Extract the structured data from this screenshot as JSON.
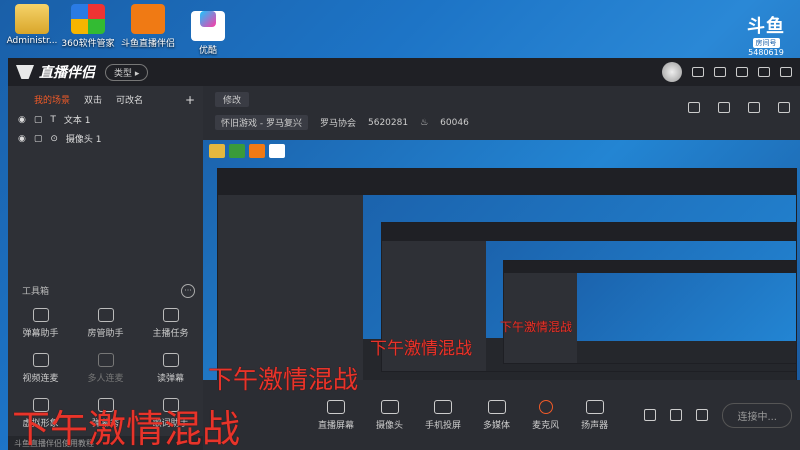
{
  "desktop": {
    "icons": [
      {
        "label": "Administr...",
        "icon": "folder-icon"
      },
      {
        "label": "360软件管家",
        "icon": "360-icon"
      },
      {
        "label": "斗鱼直播伴侣",
        "icon": "douyu-icon"
      },
      {
        "label": "优酷",
        "icon": "youku-icon"
      }
    ],
    "room_badge": {
      "logo": "斗鱼",
      "tag": "房间号",
      "room_id": "5480619"
    }
  },
  "app": {
    "title": "直播伴侣",
    "type_button": "类型 ▸",
    "sidebar": {
      "tabs": [
        "我的场景",
        "双击",
        "可改名"
      ],
      "add_label": "+",
      "sources": [
        {
          "label": "文本 1",
          "icon": "text-icon"
        },
        {
          "label": "摄像头 1",
          "icon": "camera-icon"
        }
      ],
      "toolbox_label": "工具箱",
      "more_label": "···",
      "tools": [
        {
          "label": "弹幕助手",
          "icon": "danmu-icon",
          "enabled": true
        },
        {
          "label": "房管助手",
          "icon": "admin-icon",
          "enabled": true
        },
        {
          "label": "主播任务",
          "icon": "task-icon",
          "enabled": true
        },
        {
          "label": "视频连麦",
          "icon": "video-link-icon",
          "enabled": true
        },
        {
          "label": "多人连麦",
          "icon": "multi-link-icon",
          "enabled": false
        },
        {
          "label": "读弹幕",
          "icon": "read-danmu-icon",
          "enabled": true
        },
        {
          "label": "虚拟形象",
          "icon": "avatar-icon",
          "enabled": true
        },
        {
          "label": "弹幕秀",
          "icon": "danmu-show-icon",
          "enabled": true
        },
        {
          "label": "歌词助手",
          "icon": "lyrics-icon",
          "enabled": true
        }
      ],
      "status_text": "斗鱼直播伴侣使用教程"
    },
    "main": {
      "edit_button": "修改",
      "category": "怀旧游戏 - 罗马复兴",
      "room_name": "罗马协会",
      "room_id": "5620281",
      "heat": "60046"
    },
    "overlay_text": "下午激情混战",
    "bottom": {
      "items": [
        {
          "label": "直播屏幕",
          "icon": "screen-icon"
        },
        {
          "label": "摄像头",
          "icon": "webcam-icon"
        },
        {
          "label": "手机投屏",
          "icon": "phone-cast-icon"
        },
        {
          "label": "多媒体",
          "icon": "media-icon"
        },
        {
          "label": "麦克风",
          "icon": "mic-icon"
        },
        {
          "label": "扬声器",
          "icon": "speaker-icon"
        }
      ],
      "go_live": "连接中..."
    }
  },
  "colors": {
    "accent": "#f05a28",
    "overlay": "#e8342a",
    "desktop": "#1d74c6"
  }
}
